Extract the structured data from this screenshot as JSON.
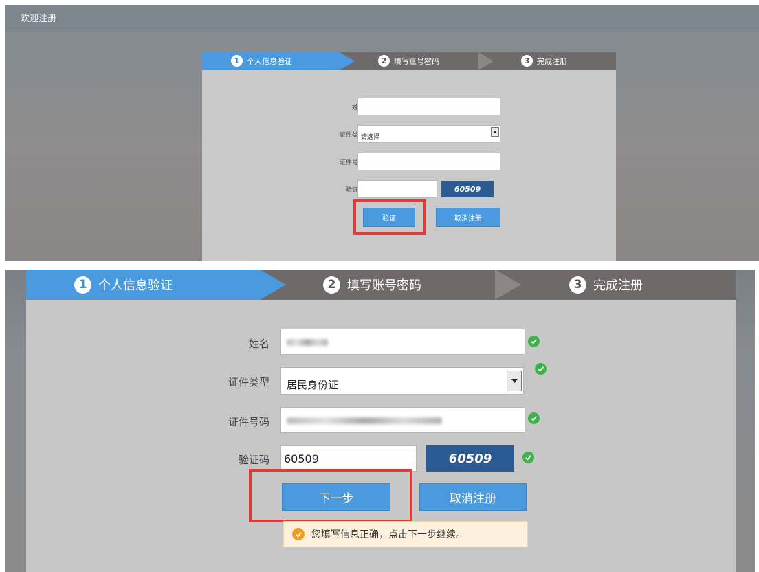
{
  "panel1": {
    "header_title": "欢迎注册",
    "steps": [
      {
        "num": "1",
        "label": "个人信息验证"
      },
      {
        "num": "2",
        "label": "填写账号密码"
      },
      {
        "num": "3",
        "label": "完成注册"
      }
    ],
    "form": {
      "name_label": "姓名",
      "id_type_label": "证件类型",
      "id_type_value": "请选择",
      "id_number_label": "证件号码",
      "captcha_label": "验证码",
      "captcha_value": "",
      "captcha_image": "60509"
    },
    "buttons": {
      "verify": "验证",
      "cancel": "取消注册"
    }
  },
  "panel2": {
    "steps": [
      {
        "num": "1",
        "label": "个人信息验证"
      },
      {
        "num": "2",
        "label": "填写账号密码"
      },
      {
        "num": "3",
        "label": "完成注册"
      }
    ],
    "form": {
      "name_label": "姓名",
      "id_type_label": "证件类型",
      "id_type_value": "居民身份证",
      "id_number_label": "证件号码",
      "captcha_label": "验证码",
      "captcha_value": "60509",
      "captcha_image": "60509"
    },
    "buttons": {
      "next": "下一步",
      "cancel": "取消注册"
    },
    "tip": "您填写信息正确，点击下一步继续。"
  },
  "colors": {
    "active_step": "#4a9ae0",
    "step_bar": "#6d6a69",
    "highlight": "#e53935",
    "valid": "#3fb24a"
  },
  "icons": [
    "check-circle-icon",
    "select-arrow-icon",
    "tip-check-icon"
  ]
}
